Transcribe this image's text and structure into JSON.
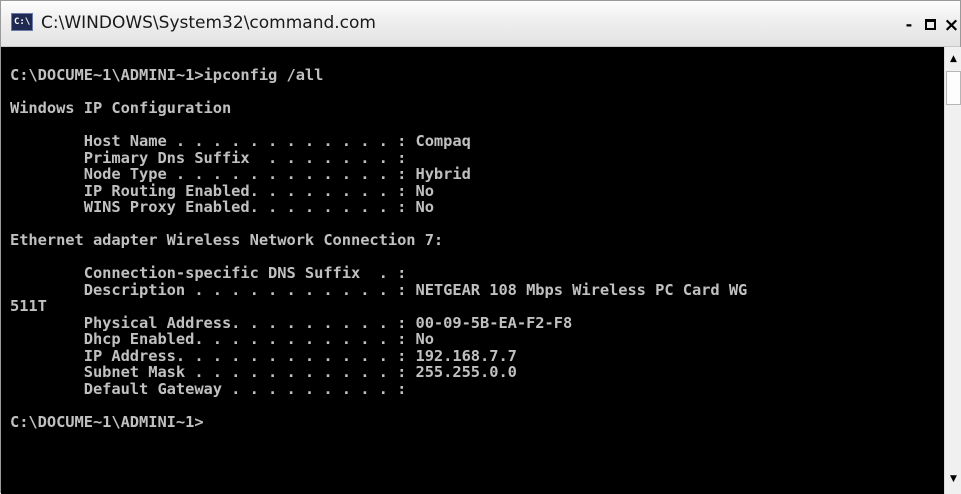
{
  "window": {
    "title": "C:\\WINDOWS\\System32\\command.com",
    "icon": "console-app-icon",
    "icon_glyph": "C:\\",
    "buttons": {
      "minimize": "-",
      "close": "×"
    }
  },
  "console": {
    "colors": {
      "background": "#000000",
      "text": "#c0c0c0"
    },
    "lines": [
      "C:\\DOCUME~1\\ADMINI~1>ipconfig /all",
      "",
      "Windows IP Configuration",
      "",
      "        Host Name . . . . . . . . . . . . : Compaq",
      "        Primary Dns Suffix  . . . . . . . :",
      "        Node Type . . . . . . . . . . . . : Hybrid",
      "        IP Routing Enabled. . . . . . . . : No",
      "        WINS Proxy Enabled. . . . . . . . : No",
      "",
      "Ethernet adapter Wireless Network Connection 7:",
      "",
      "        Connection-specific DNS Suffix  . :",
      "        Description . . . . . . . . . . . : NETGEAR 108 Mbps Wireless PC Card WG",
      "511T",
      "        Physical Address. . . . . . . . . : 00-09-5B-EA-F2-F8",
      "        Dhcp Enabled. . . . . . . . . . . : No",
      "        IP Address. . . . . . . . . . . . : 192.168.7.7",
      "        Subnet Mask . . . . . . . . . . . : 255.255.0.0",
      "        Default Gateway . . . . . . . . . :",
      "",
      "C:\\DOCUME~1\\ADMINI~1>"
    ]
  },
  "scrollbar": {
    "up_arrow": "▲",
    "down_arrow": "▼"
  }
}
